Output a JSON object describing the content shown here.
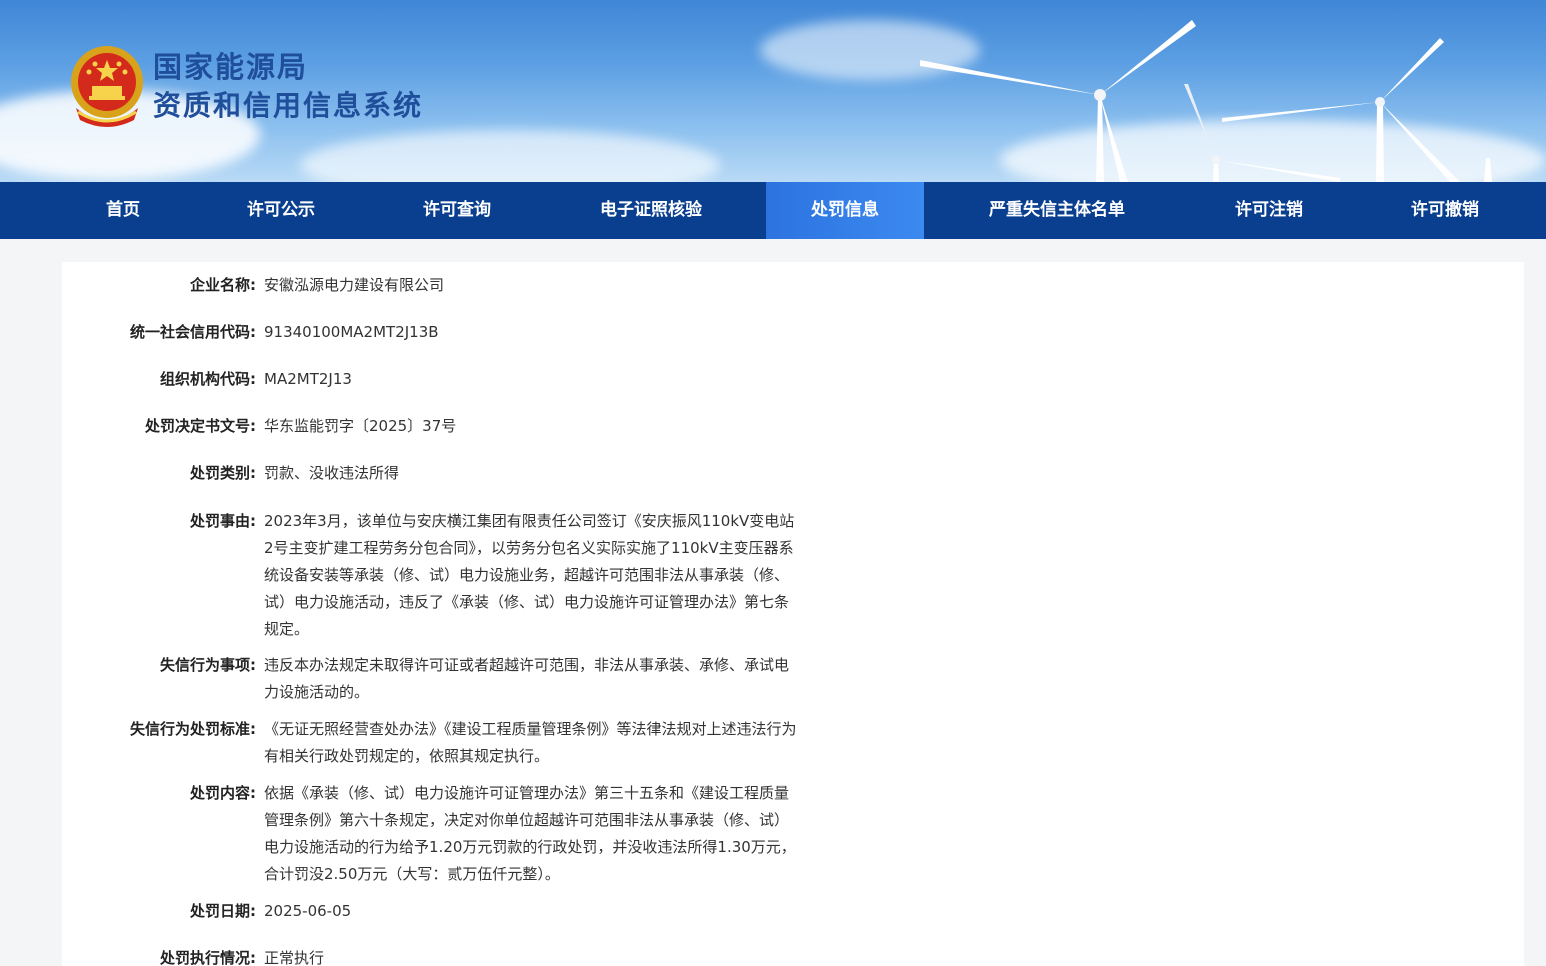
{
  "header": {
    "title_line1": "国家能源局",
    "title_line2": "资质和信用信息系统",
    "emblem_icon": "national-emblem-icon"
  },
  "nav": {
    "items": [
      {
        "label": "首页"
      },
      {
        "label": "许可公示"
      },
      {
        "label": "许可查询"
      },
      {
        "label": "电子证照核验"
      },
      {
        "label": "处罚信息",
        "active": true
      },
      {
        "label": "严重失信主体名单"
      },
      {
        "label": "许可注销"
      },
      {
        "label": "许可撤销"
      }
    ],
    "colors": {
      "bar": "#0a3f8f",
      "active": "#3b8af0"
    }
  },
  "detail": {
    "fields": [
      {
        "label": "企业名称:",
        "value": "安徽泓源电力建设有限公司"
      },
      {
        "label": "统一社会信用代码:",
        "value": "91340100MA2MT2J13B"
      },
      {
        "label": "组织机构代码:",
        "value": "MA2MT2J13"
      },
      {
        "label": "处罚决定书文号:",
        "value": "华东监能罚字〔2025〕37号"
      },
      {
        "label": "处罚类别:",
        "value": "罚款、没收违法所得"
      },
      {
        "label": "处罚事由:",
        "value": "2023年3月，该单位与安庆横江集团有限责任公司签订《安庆振风110kV变电站2号主变扩建工程劳务分包合同》，以劳务分包名义实际实施了110kV主变压器系统设备安装等承装（修、试）电力设施业务，超越许可范围非法从事承装（修、试）电力设施活动，违反了《承装（修、试）电力设施许可证管理办法》第七条规定。"
      },
      {
        "label": "失信行为事项:",
        "value": "违反本办法规定未取得许可证或者超越许可范围，非法从事承装、承修、承试电力设施活动的。"
      },
      {
        "label": "失信行为处罚标准:",
        "value": "《无证无照经营查处办法》《建设工程质量管理条例》等法律法规对上述违法行为有相关行政处罚规定的，依照其规定执行。"
      },
      {
        "label": "处罚内容:",
        "value": "依据《承装（修、试）电力设施许可证管理办法》第三十五条和《建设工程质量管理条例》第六十条规定，决定对你单位超越许可范围非法从事承装（修、试）电力设施活动的行为给予1.20万元罚款的行政处罚，并没收违法所得1.30万元，合计罚没2.50万元（大写：贰万伍仟元整）。"
      },
      {
        "label": "处罚日期:",
        "value": "2025-06-05"
      },
      {
        "label": "处罚执行情况:",
        "value": "正常执行"
      }
    ]
  }
}
